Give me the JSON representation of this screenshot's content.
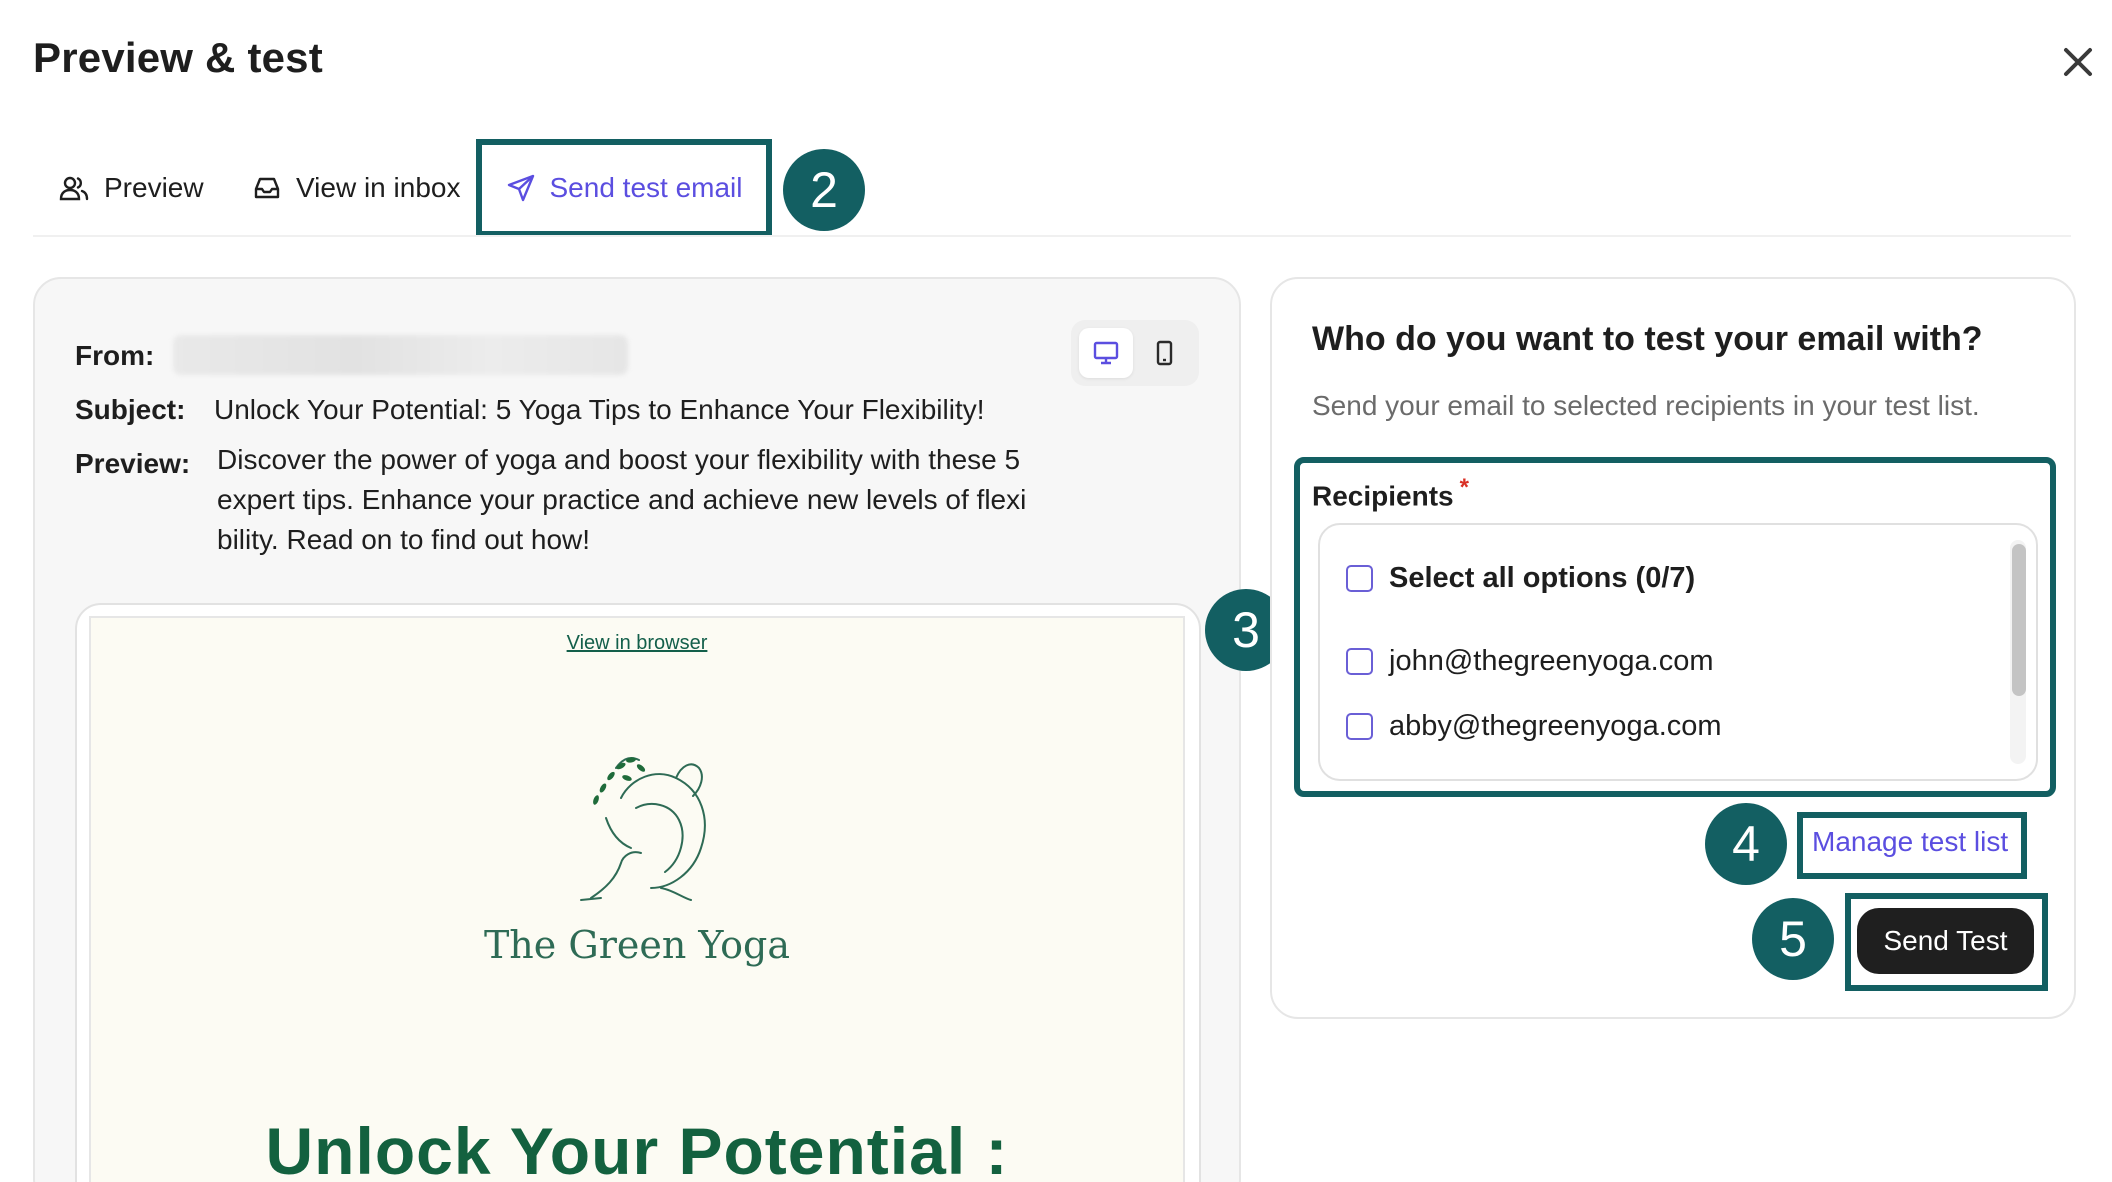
{
  "header": {
    "title": "Preview & test",
    "close_icon": "close-icon"
  },
  "tabs": [
    {
      "label": "Preview",
      "icon": "users-icon",
      "active": false
    },
    {
      "label": "View in inbox",
      "icon": "inbox-icon",
      "active": false
    },
    {
      "label": "Send test email",
      "icon": "send-icon",
      "active": true
    }
  ],
  "badges": {
    "tab_step": "2",
    "recipients_step": "3",
    "manage_step": "4",
    "send_step": "5"
  },
  "email_meta": {
    "from_label": "From:",
    "subject_label": "Subject:",
    "subject": "Unlock Your Potential: 5 Yoga Tips to Enhance Your Flexibility!",
    "preview_label": "Preview:",
    "preview_text": "Discover the power of yoga and boost your flexibility with these 5 expert tips. Enhance your practice and achieve new levels of flexibility. Read on to find out how!"
  },
  "email_body": {
    "view_in_browser": "View in browser",
    "logo_text": "The Green Yoga",
    "headline": "Unlock Your Potential :"
  },
  "test_panel": {
    "title": "Who do you want to test your email with?",
    "subtitle": "Send your email to selected recipients in your test list.",
    "recipients_label": "Recipients",
    "required_mark": "*",
    "select_all": "Select all options (0/7)",
    "options": [
      "john@thegreenyoga.com",
      "abby@thegreenyoga.com"
    ],
    "manage_link": "Manage test list",
    "send_button": "Send Test"
  },
  "colors": {
    "accent": "#5b4ee0",
    "annotation": "#135f62",
    "brand_green": "#13613f",
    "button_dark": "#1f1f1f"
  }
}
